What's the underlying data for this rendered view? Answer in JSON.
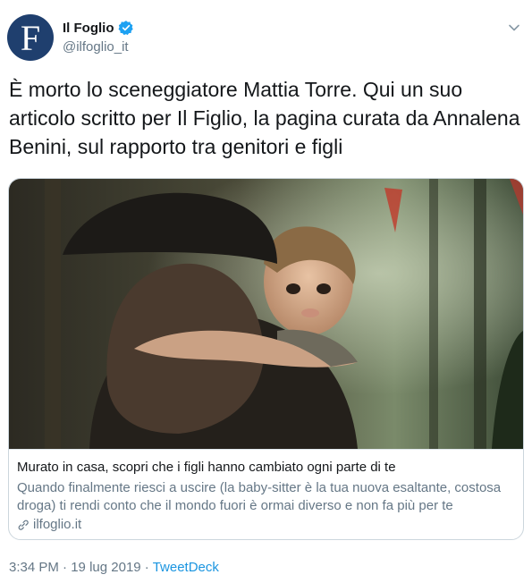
{
  "account": {
    "display_name": "Il Foglio",
    "handle": "@ilfoglio_it",
    "avatar_letter": "F"
  },
  "tweet": {
    "text": "È morto lo sceneggiatore Mattia Torre. Qui un suo articolo scritto per Il Figlio, la pagina curata da Annalena Benini, sul rapporto tra genitori e figli"
  },
  "card": {
    "title": "Murato in casa, scopri che i figli hanno cambiato ogni parte di te",
    "description": "Quando finalmente riesci a uscire (la baby-sitter è la tua nuova esaltante, costosa droga) ti rendi conto che il mondo fuori è ormai diverso e non fa più per te",
    "domain": "ilfoglio.it"
  },
  "meta": {
    "time": "3:34 PM",
    "separator": " · ",
    "date": "19 lug 2019",
    "source": "TweetDeck"
  },
  "colors": {
    "accent": "#1b95e0",
    "secondary_text": "#657786",
    "avatar_bg": "#1f3f6e"
  },
  "icons": [
    "verified-badge-icon",
    "chevron-down-icon",
    "link-icon"
  ]
}
